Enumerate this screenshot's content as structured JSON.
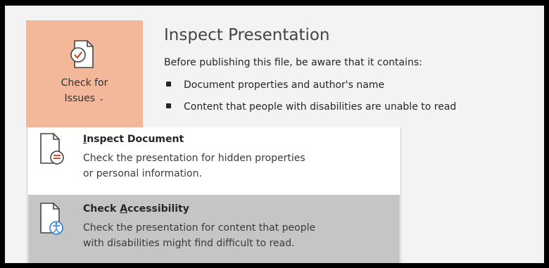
{
  "check_for_issues": {
    "line1": "Check for",
    "line2": "Issues",
    "chevron": "⌄",
    "icon": "document-check-icon"
  },
  "inspect": {
    "heading": "Inspect Presentation",
    "intro": "Before publishing this file, be aware that it contains:",
    "bullets": [
      "Document properties and author's name",
      "Content that people with disabilities are unable to read"
    ]
  },
  "menu": {
    "items": [
      {
        "title_pre": "",
        "title_key": "I",
        "title_post": "nspect Document",
        "desc1": "Check the presentation for hidden properties",
        "desc2": "or personal information.",
        "icon": "inspect-document-icon"
      },
      {
        "title_pre": "Check ",
        "title_key": "A",
        "title_post": "ccessibility",
        "desc1": "Check the presentation for content that people",
        "desc2": "with disabilities might find difficult to read.",
        "icon": "accessibility-checker-icon"
      }
    ]
  },
  "colors": {
    "button_active": "#f3b79a",
    "hover_item": "#c5c5c5",
    "accent_red": "#c43e1c",
    "accent_blue": "#2b7cd3"
  }
}
